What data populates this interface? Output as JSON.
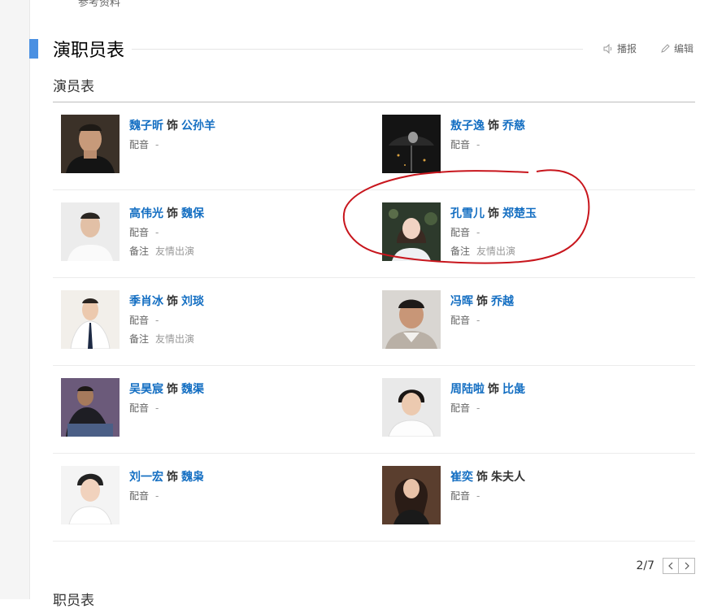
{
  "top_fragment": "参考资料",
  "section": {
    "title": "演职员表",
    "report_label": "播报",
    "edit_label": "编辑"
  },
  "cast_title": "演员表",
  "play_word": "饰",
  "dub_label": "配音",
  "note_label": "备注",
  "cast": [
    {
      "actor": "魏子昕",
      "role": "公孙羊",
      "role_linked": true,
      "dub": "-",
      "note": ""
    },
    {
      "actor": "敖子逸",
      "role": "乔慈",
      "role_linked": true,
      "dub": "-",
      "note": ""
    },
    {
      "actor": "高伟光",
      "role": "魏保",
      "role_linked": true,
      "dub": "-",
      "note": "友情出演"
    },
    {
      "actor": "孔雪儿",
      "role": "郑楚玉",
      "role_linked": true,
      "dub": "-",
      "note": "友情出演"
    },
    {
      "actor": "季肖冰",
      "role": "刘琰",
      "role_linked": true,
      "dub": "-",
      "note": "友情出演"
    },
    {
      "actor": "冯晖",
      "role": "乔越",
      "role_linked": true,
      "dub": "-",
      "note": ""
    },
    {
      "actor": "吴昊宸",
      "role": "魏渠",
      "role_linked": true,
      "dub": "-",
      "note": ""
    },
    {
      "actor": "周陆啦",
      "role": "比彘",
      "role_linked": true,
      "dub": "-",
      "note": ""
    },
    {
      "actor": "刘一宏",
      "role": "魏枭",
      "role_linked": true,
      "dub": "-",
      "note": ""
    },
    {
      "actor": "崔奕",
      "role": "朱夫人",
      "role_linked": false,
      "dub": "-",
      "note": ""
    }
  ],
  "pager": {
    "text": "2/7"
  },
  "bottom_fragment": "职员表",
  "colors": {
    "accent": "#4a90e2",
    "link": "#136ec2",
    "annotation": "#c8161d"
  }
}
